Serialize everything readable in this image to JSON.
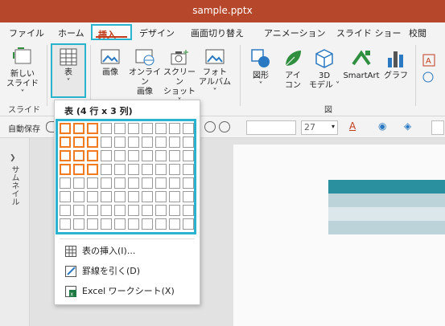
{
  "app": {
    "title": "sample.pptx"
  },
  "tabs": [
    {
      "label": "ファイル"
    },
    {
      "label": "ホーム"
    },
    {
      "label": "挿入"
    },
    {
      "label": "デザイン"
    },
    {
      "label": "画面切り替え"
    },
    {
      "label": "アニメーション"
    },
    {
      "label": "スライド ショー"
    },
    {
      "label": "校閲"
    }
  ],
  "ribbon": {
    "new_slide": {
      "line1": "新しい",
      "line2": "スライド ˅"
    },
    "table": {
      "line1": "表",
      "line2": "˅"
    },
    "image": {
      "line1": "画像"
    },
    "online_image": {
      "line1": "オンライン",
      "line2": "画像"
    },
    "screenshot": {
      "line1": "スクリーン",
      "line2": "ショット ˅"
    },
    "photo_album": {
      "line1": "フォト",
      "line2": "アルバム ˅"
    },
    "shapes": {
      "line1": "図形",
      "line2": "˅"
    },
    "icons": {
      "line1": "アイ",
      "line2": "コン"
    },
    "models3d": {
      "line1": "3D",
      "line2": "モデル ˅"
    },
    "smartart": {
      "line1": "SmartArt"
    },
    "graph": {
      "line1": "グラフ"
    },
    "group_slide": "スライド",
    "group_figure": "図"
  },
  "quick_access": {
    "autosave": "自動保存",
    "font_size": "27"
  },
  "side": {
    "thumbnail_label": "サムネイル"
  },
  "table_dropdown": {
    "title": "表 (4 行 x 3 列)",
    "rows": 8,
    "cols": 10,
    "selected_rows": 4,
    "selected_cols": 3,
    "items": [
      {
        "label": "表の挿入(I)..."
      },
      {
        "label": "罫線を引く(D)"
      },
      {
        "label": "Excel ワークシート(X)"
      }
    ]
  },
  "colors": {
    "accent": "#29b3cf",
    "title_bar": "#b7472a",
    "selection": "#f07b20"
  }
}
